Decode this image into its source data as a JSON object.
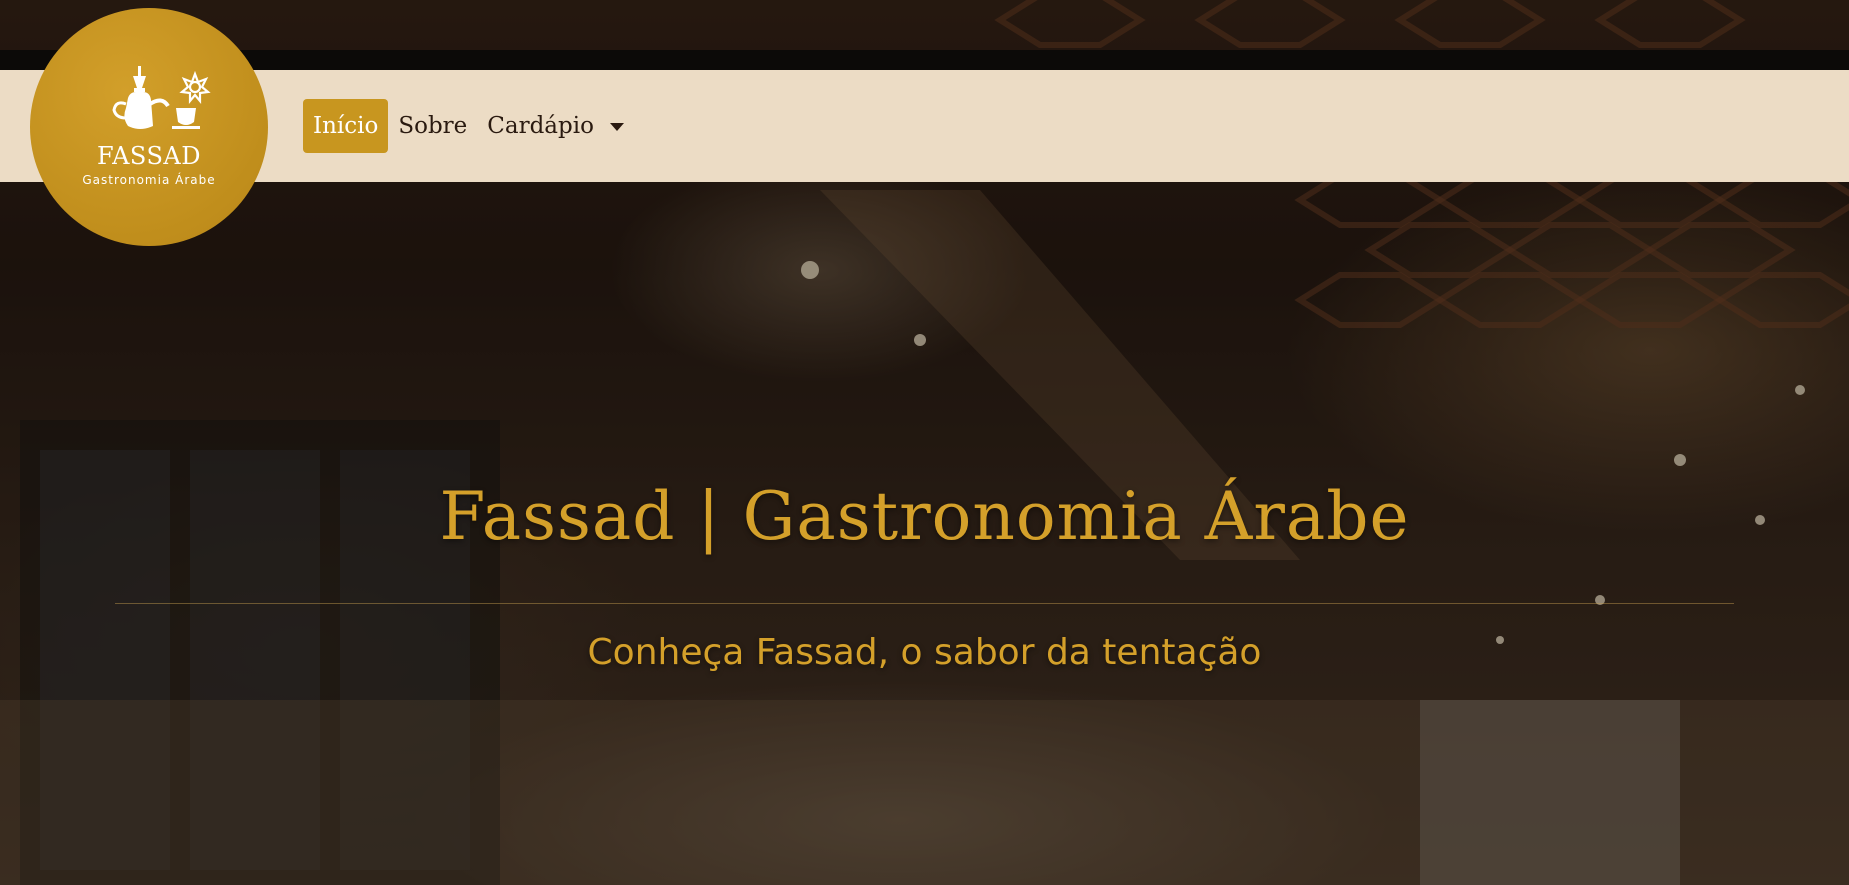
{
  "brand": {
    "name": "FASSAD",
    "subtitle": "Gastronomia Árabe",
    "color": "#c8961f"
  },
  "nav": {
    "items": [
      {
        "label": "Início",
        "active": true
      },
      {
        "label": "Sobre",
        "active": false
      },
      {
        "label": "Cardápio",
        "active": false,
        "dropdown": true
      }
    ]
  },
  "hero": {
    "title": "Fassad | Gastronomia Árabe",
    "tagline": "Conheça Fassad, o sabor da tentação",
    "accent_color": "#d4a02a"
  },
  "icons": [
    "coffee-pot-logo-icon",
    "chevron-down-icon"
  ]
}
